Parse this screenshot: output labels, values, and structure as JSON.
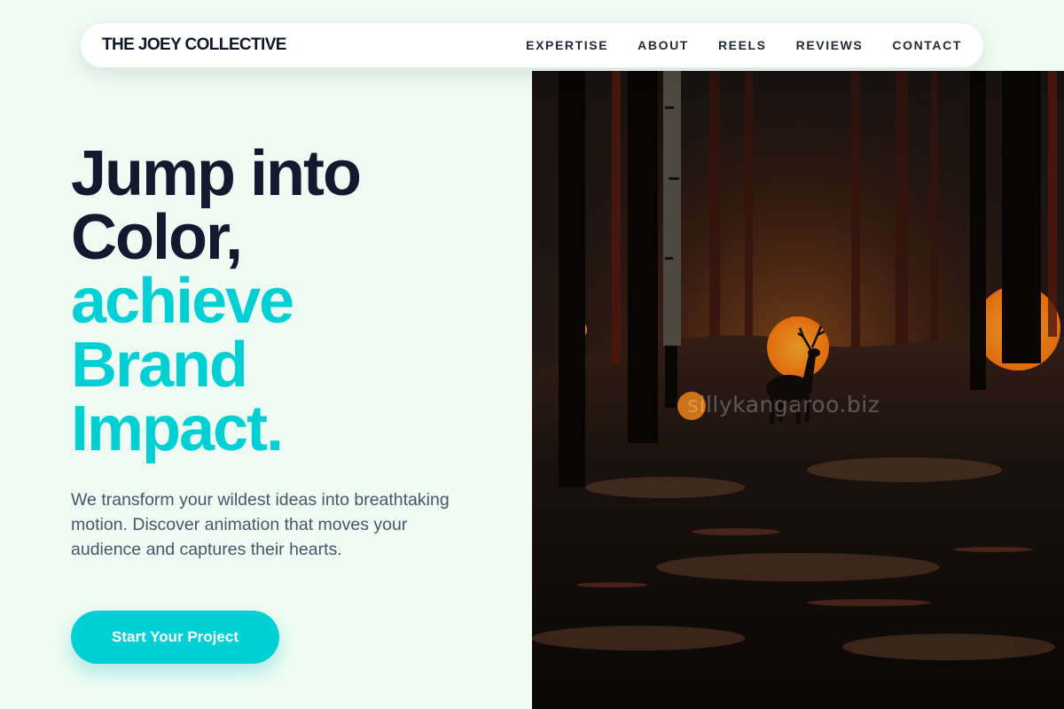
{
  "nav": {
    "brand": "THE JOEY COLLECTIVE",
    "links": [
      "EXPERTISE",
      "ABOUT",
      "REELS",
      "REVIEWS",
      "CONTACT"
    ]
  },
  "hero": {
    "headline_dark": [
      "Jump into",
      "Color,"
    ],
    "headline_accent": [
      "achieve",
      "Brand",
      "Impact."
    ],
    "subtext": "We transform your wildest ideas into breathtaking motion. Discover animation that moves your audience and captures their hearts.",
    "cta_label": "Start Your Project",
    "image_watermark": "sillykangaroo.biz"
  },
  "colors": {
    "background": "#effcf4",
    "text_dark": "#111a2e",
    "accent": "#00cfd3",
    "body_text": "#475569"
  }
}
